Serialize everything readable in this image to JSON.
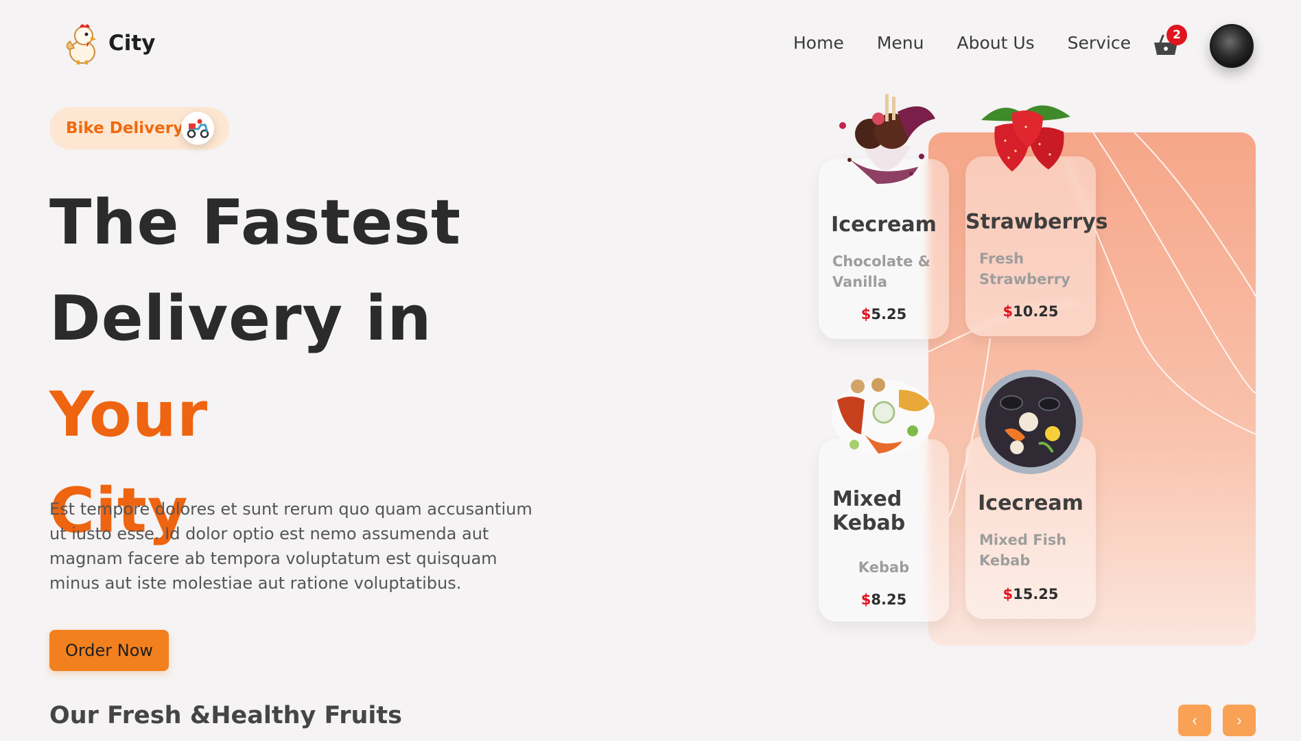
{
  "brand": {
    "name": "City"
  },
  "nav": {
    "items": [
      "Home",
      "Menu",
      "About Us",
      "Service"
    ]
  },
  "cart": {
    "count": "2"
  },
  "hero": {
    "pill_label": "Bike Delivery",
    "headline_line1": "The Fastest",
    "headline_line2_plain": "Delivery in",
    "headline_line2_accent": "Your",
    "headline_line3_accent": "City",
    "description": "Est tempore dolores et sunt rerum quo quam accusantium ut iusto esse. Id dolor optio est nemo assumenda aut magnam facere ab tempora voluptatum est quisquam minus aut iste molestiae aut ratione voluptatibus.",
    "cta_label": "Order Now"
  },
  "cards": [
    {
      "title": "Icecream",
      "subtitle": "Chocolate & Vanilla",
      "currency": "$",
      "price": "5.25"
    },
    {
      "title": "Strawberrys",
      "subtitle": "Fresh Strawberry",
      "currency": "$",
      "price": "10.25"
    },
    {
      "title": "Mixed Kebab",
      "subtitle": "Kebab",
      "currency": "$",
      "price": "8.25"
    },
    {
      "title": "Icecream",
      "subtitle": "Mixed Fish Kebab",
      "currency": "$",
      "price": "15.25"
    }
  ],
  "section": {
    "title": "Our Fresh &Healthy Fruits"
  },
  "carousel": {
    "prev_icon": "chevron-left-icon",
    "next_icon": "chevron-right-icon",
    "prev_glyph": "‹",
    "next_glyph": "›"
  },
  "colors": {
    "accent": "#ee6410",
    "button": "#f2801f",
    "badge": "#e0141f",
    "panel": "#f6a689"
  }
}
